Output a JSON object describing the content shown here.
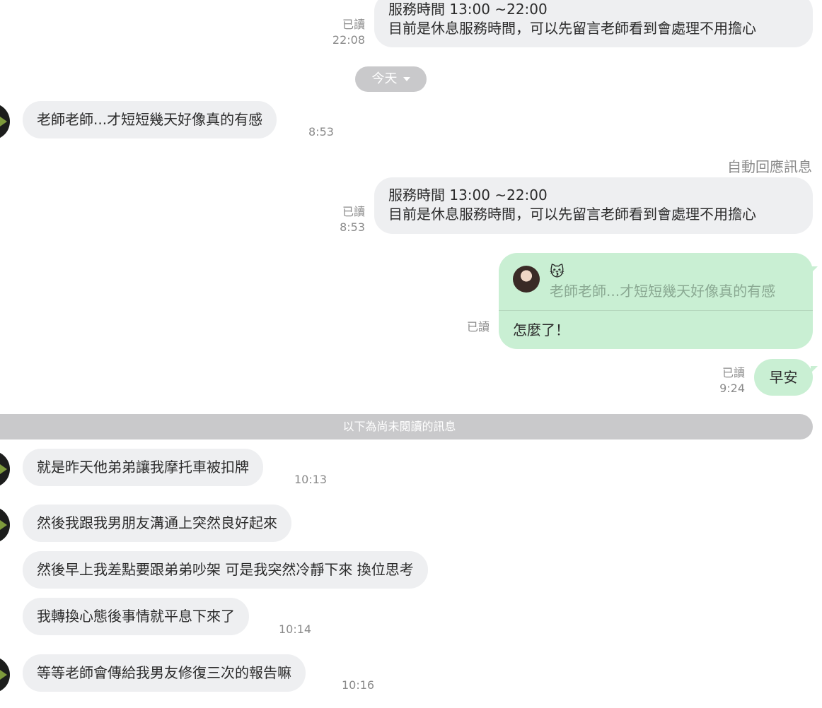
{
  "messages_top": {
    "first_line": "服務時間 13:00 ~22:00",
    "second_line": "目前是休息服務時間，可以先留言老師看到會處理不用擔心",
    "read": "已讀",
    "time": "22:08"
  },
  "date_pill": {
    "label": "今天"
  },
  "incoming_1": {
    "text": "老師老師...才短短幾天好像真的有感",
    "time": "8:53"
  },
  "auto_reply": {
    "label": "自動回應訊息",
    "first_line": "服務時間 13:00 ~22:00",
    "second_line": "目前是休息服務時間，可以先留言老師看到會處理不用擔心",
    "read": "已讀",
    "time": "8:53"
  },
  "reply": {
    "emoji": "😽",
    "quote": "老師老師...才短短幾天好像真的有感",
    "text": "怎麼了！",
    "read": "已讀"
  },
  "good_morning": {
    "text": "早安",
    "read": "已讀",
    "time": "9:24"
  },
  "unread_divider": {
    "label": "以下為尚未閱讀的訊息"
  },
  "incoming_2": {
    "text": "就是昨天他弟弟讓我摩托車被扣牌",
    "time": "10:13"
  },
  "incoming_3": {
    "text": "然後我跟我男朋友溝通上突然良好起來"
  },
  "incoming_4": {
    "text": "然後早上我差點要跟弟弟吵架 可是我突然冷靜下來 換位思考"
  },
  "incoming_5": {
    "text": "我轉換心態後事情就平息下來了",
    "time": "10:14"
  },
  "incoming_6": {
    "text": "等等老師會傳給我男友修復三次的報告嘛",
    "time": "10:16"
  },
  "colors": {
    "incoming_bubble": "#eeeff1",
    "outgoing_bubble": "#c9efd3",
    "pill": "#c9c9cb",
    "meta_text": "#8a8a8a"
  }
}
